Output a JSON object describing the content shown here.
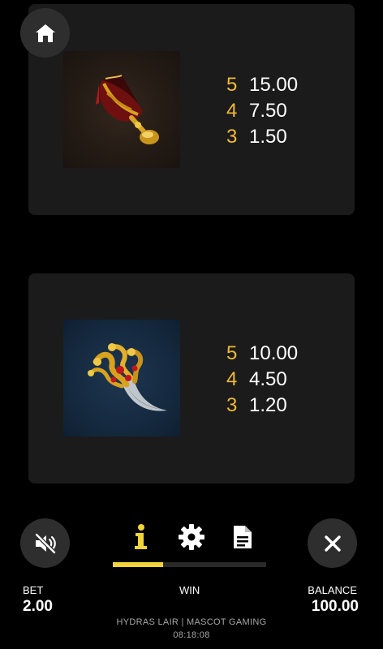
{
  "paytables": [
    {
      "symbol_icon": "goblet-icon",
      "symbol_color": "#231a14",
      "rows": [
        {
          "count": "5",
          "value": "15.00"
        },
        {
          "count": "4",
          "value": "7.50"
        },
        {
          "count": "3",
          "value": "1.50"
        }
      ]
    },
    {
      "symbol_icon": "hydra-dagger-icon",
      "symbol_color": "#152a40",
      "rows": [
        {
          "count": "5",
          "value": "10.00"
        },
        {
          "count": "4",
          "value": "4.50"
        },
        {
          "count": "3",
          "value": "1.20"
        }
      ]
    }
  ],
  "nav": {
    "home_icon": "home-icon",
    "sound_icon": "sound-muted-icon",
    "close_icon": "close-icon",
    "tabs": [
      {
        "icon": "info-icon",
        "active": true
      },
      {
        "icon": "gear-icon",
        "active": false
      },
      {
        "icon": "document-icon",
        "active": false
      }
    ],
    "active_tab_progress": 0.33
  },
  "footer": {
    "bet_label": "BET",
    "bet_value": "2.00",
    "win_label": "WIN",
    "balance_label": "BALANCE",
    "balance_value": "100.00",
    "game_title": "HYDRAS LAIR | MASCOT GAMING",
    "clock": "08:18:08"
  },
  "colors": {
    "accent": "#f2b935",
    "tab_active": "#f2d43a",
    "panel": "#1b1b1b",
    "button": "#2e2e2e"
  }
}
